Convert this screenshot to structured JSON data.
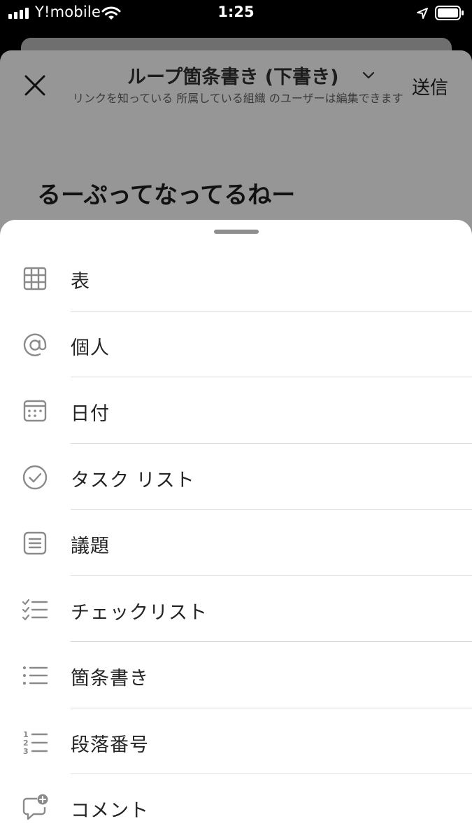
{
  "status_bar": {
    "carrier": "Y!mobile",
    "time": "1:25"
  },
  "document": {
    "title": "ループ箇条書き (下書き)",
    "subtitle": "リンクを知っている 所属している組織 のユーザーは編集できます",
    "send_label": "送信",
    "heading": "るーぷってなってるねー"
  },
  "insert_menu": {
    "items": [
      {
        "label": "表",
        "icon": "table-icon"
      },
      {
        "label": "個人",
        "icon": "at-mention-icon"
      },
      {
        "label": "日付",
        "icon": "calendar-icon"
      },
      {
        "label": "タスク リスト",
        "icon": "check-circle-icon"
      },
      {
        "label": "議題",
        "icon": "agenda-icon"
      },
      {
        "label": "チェックリスト",
        "icon": "checklist-icon"
      },
      {
        "label": "箇条書き",
        "icon": "bullet-list-icon"
      },
      {
        "label": "段落番号",
        "icon": "numbered-list-icon"
      },
      {
        "label": "コメント",
        "icon": "comment-add-icon"
      }
    ]
  },
  "colors": {
    "icon_gray": "#8a8a8a",
    "label_text": "#242424",
    "overlay_sheet": "#969696"
  }
}
